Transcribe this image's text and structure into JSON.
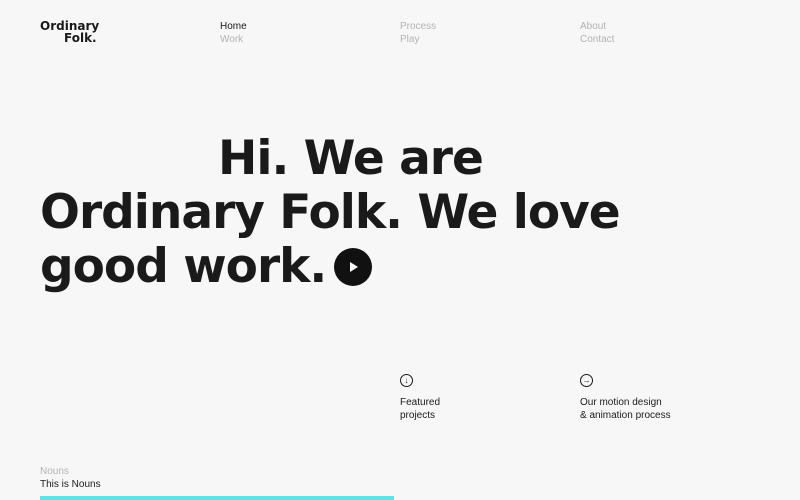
{
  "logo": {
    "line1": "Ordinary",
    "line2": "Folk."
  },
  "nav": {
    "col1": [
      "Home",
      "Work"
    ],
    "col2": [
      "Process",
      "Play"
    ],
    "col3": [
      "About",
      "Contact"
    ],
    "active": "Home"
  },
  "hero": {
    "line1": "Hi. We are",
    "line2": "Ordinary Folk. We love",
    "line3": "good work."
  },
  "links": {
    "featured": {
      "icon": "arrow-down-circle-icon",
      "line1": "Featured",
      "line2": "projects"
    },
    "process": {
      "icon": "arrow-right-circle-icon",
      "line1": "Our motion design",
      "line2": "& animation process"
    }
  },
  "project": {
    "category": "Nouns",
    "title": "This is Nouns",
    "accent": "#5fe3e6"
  }
}
